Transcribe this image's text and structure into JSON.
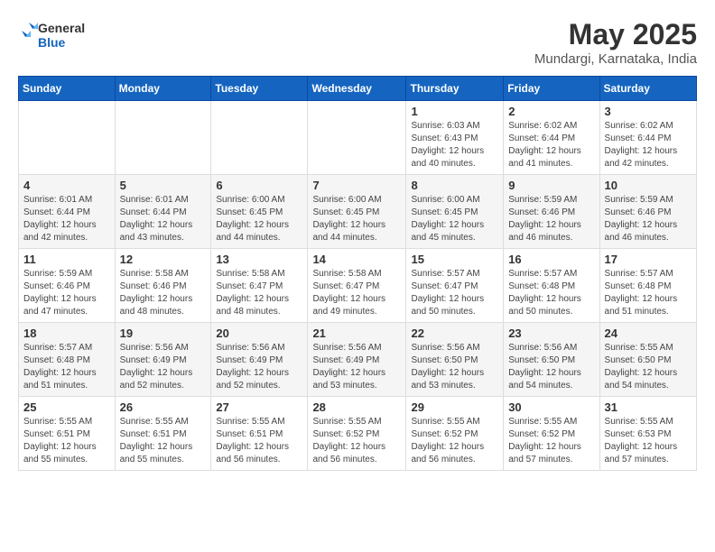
{
  "logo": {
    "line1": "General",
    "line2": "Blue"
  },
  "title": {
    "month_year": "May 2025",
    "location": "Mundargi, Karnataka, India"
  },
  "days_of_week": [
    "Sunday",
    "Monday",
    "Tuesday",
    "Wednesday",
    "Thursday",
    "Friday",
    "Saturday"
  ],
  "weeks": [
    [
      {
        "day": "",
        "info": ""
      },
      {
        "day": "",
        "info": ""
      },
      {
        "day": "",
        "info": ""
      },
      {
        "day": "",
        "info": ""
      },
      {
        "day": "1",
        "info": "Sunrise: 6:03 AM\nSunset: 6:43 PM\nDaylight: 12 hours\nand 40 minutes."
      },
      {
        "day": "2",
        "info": "Sunrise: 6:02 AM\nSunset: 6:44 PM\nDaylight: 12 hours\nand 41 minutes."
      },
      {
        "day": "3",
        "info": "Sunrise: 6:02 AM\nSunset: 6:44 PM\nDaylight: 12 hours\nand 42 minutes."
      }
    ],
    [
      {
        "day": "4",
        "info": "Sunrise: 6:01 AM\nSunset: 6:44 PM\nDaylight: 12 hours\nand 42 minutes."
      },
      {
        "day": "5",
        "info": "Sunrise: 6:01 AM\nSunset: 6:44 PM\nDaylight: 12 hours\nand 43 minutes."
      },
      {
        "day": "6",
        "info": "Sunrise: 6:00 AM\nSunset: 6:45 PM\nDaylight: 12 hours\nand 44 minutes."
      },
      {
        "day": "7",
        "info": "Sunrise: 6:00 AM\nSunset: 6:45 PM\nDaylight: 12 hours\nand 44 minutes."
      },
      {
        "day": "8",
        "info": "Sunrise: 6:00 AM\nSunset: 6:45 PM\nDaylight: 12 hours\nand 45 minutes."
      },
      {
        "day": "9",
        "info": "Sunrise: 5:59 AM\nSunset: 6:46 PM\nDaylight: 12 hours\nand 46 minutes."
      },
      {
        "day": "10",
        "info": "Sunrise: 5:59 AM\nSunset: 6:46 PM\nDaylight: 12 hours\nand 46 minutes."
      }
    ],
    [
      {
        "day": "11",
        "info": "Sunrise: 5:59 AM\nSunset: 6:46 PM\nDaylight: 12 hours\nand 47 minutes."
      },
      {
        "day": "12",
        "info": "Sunrise: 5:58 AM\nSunset: 6:46 PM\nDaylight: 12 hours\nand 48 minutes."
      },
      {
        "day": "13",
        "info": "Sunrise: 5:58 AM\nSunset: 6:47 PM\nDaylight: 12 hours\nand 48 minutes."
      },
      {
        "day": "14",
        "info": "Sunrise: 5:58 AM\nSunset: 6:47 PM\nDaylight: 12 hours\nand 49 minutes."
      },
      {
        "day": "15",
        "info": "Sunrise: 5:57 AM\nSunset: 6:47 PM\nDaylight: 12 hours\nand 50 minutes."
      },
      {
        "day": "16",
        "info": "Sunrise: 5:57 AM\nSunset: 6:48 PM\nDaylight: 12 hours\nand 50 minutes."
      },
      {
        "day": "17",
        "info": "Sunrise: 5:57 AM\nSunset: 6:48 PM\nDaylight: 12 hours\nand 51 minutes."
      }
    ],
    [
      {
        "day": "18",
        "info": "Sunrise: 5:57 AM\nSunset: 6:48 PM\nDaylight: 12 hours\nand 51 minutes."
      },
      {
        "day": "19",
        "info": "Sunrise: 5:56 AM\nSunset: 6:49 PM\nDaylight: 12 hours\nand 52 minutes."
      },
      {
        "day": "20",
        "info": "Sunrise: 5:56 AM\nSunset: 6:49 PM\nDaylight: 12 hours\nand 52 minutes."
      },
      {
        "day": "21",
        "info": "Sunrise: 5:56 AM\nSunset: 6:49 PM\nDaylight: 12 hours\nand 53 minutes."
      },
      {
        "day": "22",
        "info": "Sunrise: 5:56 AM\nSunset: 6:50 PM\nDaylight: 12 hours\nand 53 minutes."
      },
      {
        "day": "23",
        "info": "Sunrise: 5:56 AM\nSunset: 6:50 PM\nDaylight: 12 hours\nand 54 minutes."
      },
      {
        "day": "24",
        "info": "Sunrise: 5:55 AM\nSunset: 6:50 PM\nDaylight: 12 hours\nand 54 minutes."
      }
    ],
    [
      {
        "day": "25",
        "info": "Sunrise: 5:55 AM\nSunset: 6:51 PM\nDaylight: 12 hours\nand 55 minutes."
      },
      {
        "day": "26",
        "info": "Sunrise: 5:55 AM\nSunset: 6:51 PM\nDaylight: 12 hours\nand 55 minutes."
      },
      {
        "day": "27",
        "info": "Sunrise: 5:55 AM\nSunset: 6:51 PM\nDaylight: 12 hours\nand 56 minutes."
      },
      {
        "day": "28",
        "info": "Sunrise: 5:55 AM\nSunset: 6:52 PM\nDaylight: 12 hours\nand 56 minutes."
      },
      {
        "day": "29",
        "info": "Sunrise: 5:55 AM\nSunset: 6:52 PM\nDaylight: 12 hours\nand 56 minutes."
      },
      {
        "day": "30",
        "info": "Sunrise: 5:55 AM\nSunset: 6:52 PM\nDaylight: 12 hours\nand 57 minutes."
      },
      {
        "day": "31",
        "info": "Sunrise: 5:55 AM\nSunset: 6:53 PM\nDaylight: 12 hours\nand 57 minutes."
      }
    ]
  ]
}
